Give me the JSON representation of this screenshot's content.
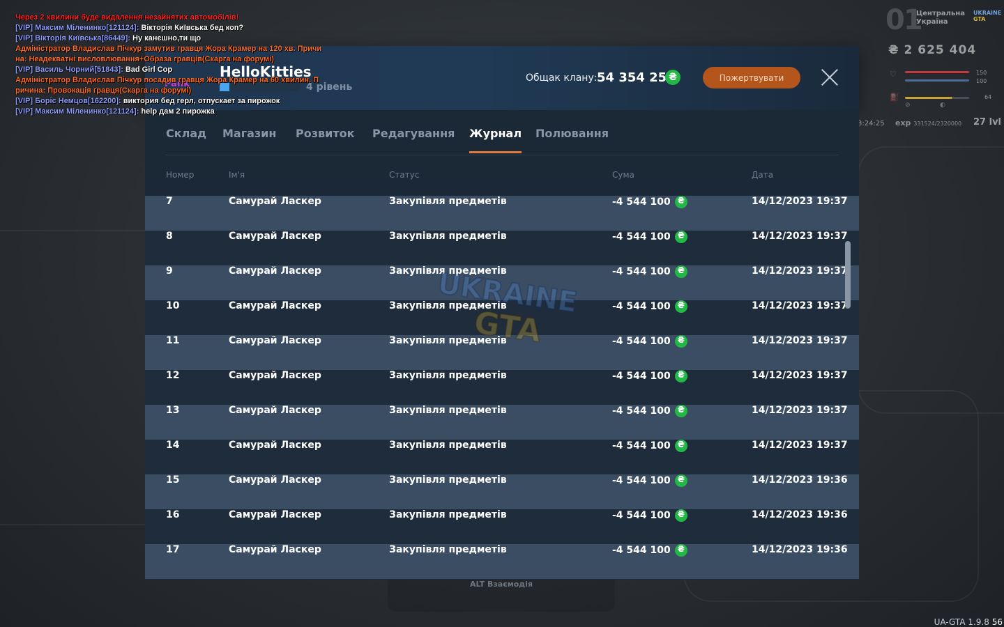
{
  "chat": [
    [
      {
        "t": "Через 2 хвилини буде видалення незайнятих автомобілів!",
        "c": "c-red"
      }
    ],
    [
      {
        "t": " [VIP] Максим Міленинко[121124]: ",
        "c": "c-vip"
      },
      {
        "t": "Вікторія Київська бед коп?",
        "c": "c-msg"
      }
    ],
    [
      {
        "t": " [VIP] Вікторія Київська[86449]: ",
        "c": "c-vip"
      },
      {
        "t": "Ну канєшно,ти що",
        "c": "c-msg"
      }
    ],
    [
      {
        "t": "Адміністратор Владислав Пічкур замутив гравця Жора Крамер на 120 хв. Причи",
        "c": "c-orange"
      }
    ],
    [
      {
        "t": "на: Неадекватні висловлювання+Образа гравців(Скарга на форумі)",
        "c": "c-orange"
      }
    ],
    [
      {
        "t": " [VIP] Василь Чорний[51843]: ",
        "c": "c-vip"
      },
      {
        "t": "Bad Girl Cop",
        "c": "c-msg"
      }
    ],
    [
      {
        "t": "Адміністратор Владислав Пічкур посадив гравця Жора Крамер на 60 хвилин. П",
        "c": "c-orange"
      }
    ],
    [
      {
        "t": "ричина: Провокація гравця(Скарга на форумі)",
        "c": "c-orange"
      }
    ],
    [
      {
        "t": " [VIP] Борiс Немцов[162200]: ",
        "c": "c-vip"
      },
      {
        "t": "виктория бед герл, отпускает за пирожок",
        "c": "c-msg"
      }
    ],
    [
      {
        "t": " [VIP] Максим Міленинко[121124]: ",
        "c": "c-vip"
      },
      {
        "t": "help дам 2 пирожка",
        "c": "c-msg"
      }
    ]
  ],
  "hud": {
    "server_number": "01",
    "region": "Центральна Україна",
    "brand_top": "UKRAINE",
    "brand_bottom": "GTA",
    "money": "₴ 2 625 404",
    "stat_a": "150",
    "stat_b": "100",
    "stat_c": "64",
    "time": "3:24:25",
    "exp_label": "exp",
    "exp_value": "331524/2320000",
    "level": "27 lvl"
  },
  "clan": {
    "tag": "Pank",
    "name": "HelloKitties",
    "level": "4 рівень",
    "level_progress": 0.12,
    "bank_label": "Общак клану:",
    "bank_value": "54 354 256",
    "donate_label": "Пожертвувати"
  },
  "currency_symbol": "₴",
  "tabs": [
    "Склад",
    "Магазин",
    "Розвиток",
    "Редагування",
    "Журнал",
    "Полювання"
  ],
  "active_tab": "Журнал",
  "columns": {
    "number": "Номер",
    "name": "Ім'я",
    "status": "Статус",
    "sum": "Сума",
    "date": "Дата"
  },
  "journal": [
    {
      "num": "7",
      "name": "Самурай Ласкер",
      "status": "Закупівля предметів",
      "sum": "-4 544 100",
      "date": "14/12/2023 19:37"
    },
    {
      "num": "8",
      "name": "Самурай Ласкер",
      "status": "Закупівля предметів",
      "sum": "-4 544 100",
      "date": "14/12/2023 19:37"
    },
    {
      "num": "9",
      "name": "Самурай Ласкер",
      "status": "Закупівля предметів",
      "sum": "-4 544 100",
      "date": "14/12/2023 19:37"
    },
    {
      "num": "10",
      "name": "Самурай Ласкер",
      "status": "Закупівля предметів",
      "sum": "-4 544 100",
      "date": "14/12/2023 19:37"
    },
    {
      "num": "11",
      "name": "Самурай Ласкер",
      "status": "Закупівля предметів",
      "sum": "-4 544 100",
      "date": "14/12/2023 19:37"
    },
    {
      "num": "12",
      "name": "Самурай Ласкер",
      "status": "Закупівля предметів",
      "sum": "-4 544 100",
      "date": "14/12/2023 19:37"
    },
    {
      "num": "13",
      "name": "Самурай Ласкер",
      "status": "Закупівля предметів",
      "sum": "-4 544 100",
      "date": "14/12/2023 19:37"
    },
    {
      "num": "14",
      "name": "Самурай Ласкер",
      "status": "Закупівля предметів",
      "sum": "-4 544 100",
      "date": "14/12/2023 19:37"
    },
    {
      "num": "15",
      "name": "Самурай Ласкер",
      "status": "Закупівля предметів",
      "sum": "-4 544 100",
      "date": "14/12/2023 19:36"
    },
    {
      "num": "16",
      "name": "Самурай Ласкер",
      "status": "Закупівля предметів",
      "sum": "-4 544 100",
      "date": "14/12/2023 19:36"
    },
    {
      "num": "17",
      "name": "Самурай Ласкер",
      "status": "Закупівля предметів",
      "sum": "-4 544 100",
      "date": "14/12/2023 19:36"
    }
  ],
  "watermark": {
    "top": "UKRAINE",
    "bottom": "GTA"
  },
  "alt_hint": "ALT Взаємодія",
  "version": "UA-GTA 1.9.8",
  "fps": "56",
  "colors": {
    "accent_orange": "#e07a3a",
    "coin_green": "#22b845",
    "row_light": "#3b4d63",
    "row_dark": "#1e2c3b"
  }
}
